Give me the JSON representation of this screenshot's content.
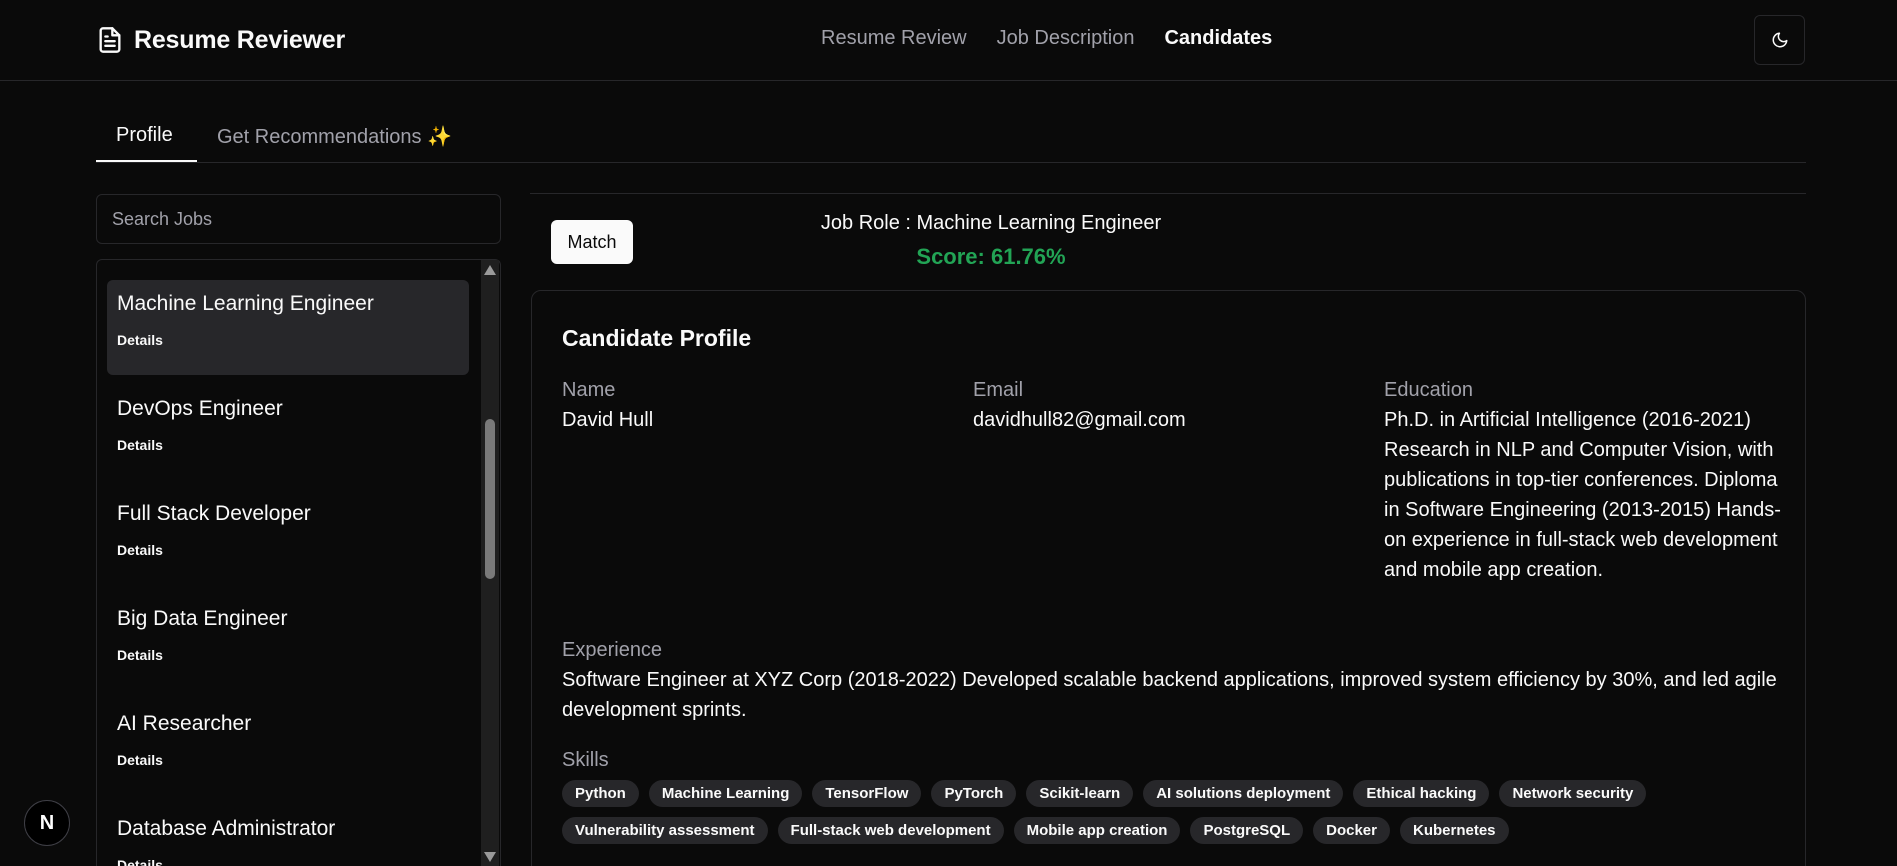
{
  "app": {
    "title": "Resume Reviewer"
  },
  "nav": [
    {
      "label": "Resume Review",
      "active": false
    },
    {
      "label": "Job Description",
      "active": false
    },
    {
      "label": "Candidates",
      "active": true
    }
  ],
  "tabs": {
    "profile": "Profile",
    "recommendations": "Get Recommendations ✨"
  },
  "search": {
    "placeholder": "Search Jobs",
    "value": ""
  },
  "jobs": [
    {
      "title": "Machine Learning Engineer",
      "details": "Details",
      "selected": true
    },
    {
      "title": "DevOps Engineer",
      "details": "Details"
    },
    {
      "title": "Full Stack Developer",
      "details": "Details"
    },
    {
      "title": "Big Data Engineer",
      "details": "Details"
    },
    {
      "title": "AI Researcher",
      "details": "Details"
    },
    {
      "title": "Database Administrator",
      "details": "Details"
    }
  ],
  "match": {
    "button_label": "Match",
    "job_role": "Job Role : Machine Learning Engineer",
    "score": "Score: 61.76%",
    "score_color": "#22a455"
  },
  "profile": {
    "heading": "Candidate Profile",
    "name_label": "Name",
    "name": "David Hull",
    "email_label": "Email",
    "email": "davidhull82@gmail.com",
    "education_label": "Education",
    "education": "Ph.D. in Artificial Intelligence (2016-2021) Research in NLP and Computer Vision, with publications in top-tier conferences. Diploma in Software Engineering (2013-2015) Hands-on experience in full-stack web development and mobile app creation.",
    "experience_label": "Experience",
    "experience": "Software Engineer at XYZ Corp (2018-2022) Developed scalable backend applications, improved system efficiency by 30%, and led agile development sprints.",
    "skills_label": "Skills",
    "skills": [
      "Python",
      "Machine Learning",
      "TensorFlow",
      "PyTorch",
      "Scikit-learn",
      "AI solutions deployment",
      "Ethical hacking",
      "Network security",
      "Vulnerability assessment",
      "Full-stack web development",
      "Mobile app creation",
      "PostgreSQL",
      "Docker",
      "Kubernetes"
    ]
  },
  "badge": {
    "letter": "N"
  },
  "icons": {
    "brand": "file-text-icon",
    "theme": "moon-icon"
  },
  "colors": {
    "background": "#0a0a0a",
    "border": "#27272a",
    "muted": "#a1a1aa",
    "accent_green": "#22a455"
  }
}
